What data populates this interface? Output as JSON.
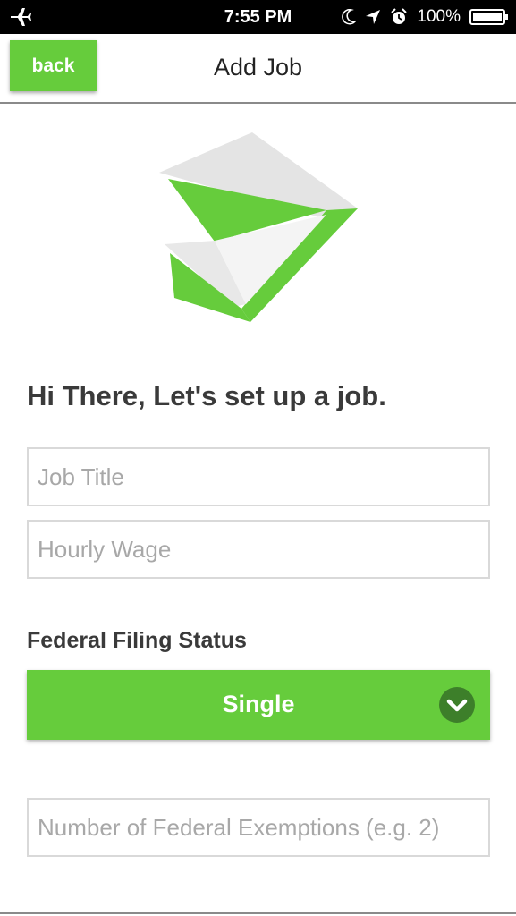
{
  "status_bar": {
    "time": "7:55 PM",
    "battery_percent": "100%",
    "icons": [
      "airplane-icon",
      "moon-icon",
      "location-arrow-icon",
      "alarm-icon",
      "battery-icon"
    ]
  },
  "nav": {
    "back_label": "back",
    "title": "Add Job"
  },
  "form": {
    "heading": "Hi There, Let's set up a job.",
    "job_title_placeholder": "Job Title",
    "hourly_wage_placeholder": "Hourly Wage",
    "filing_status_label": "Federal Filing Status",
    "filing_status_value": "Single",
    "exemptions_placeholder": "Number of Federal Exemptions (e.g. 2)"
  },
  "colors": {
    "accent_green": "#66cc3c",
    "dark_green": "#3d7f2a",
    "logo_gray": "#e3e3e3"
  }
}
